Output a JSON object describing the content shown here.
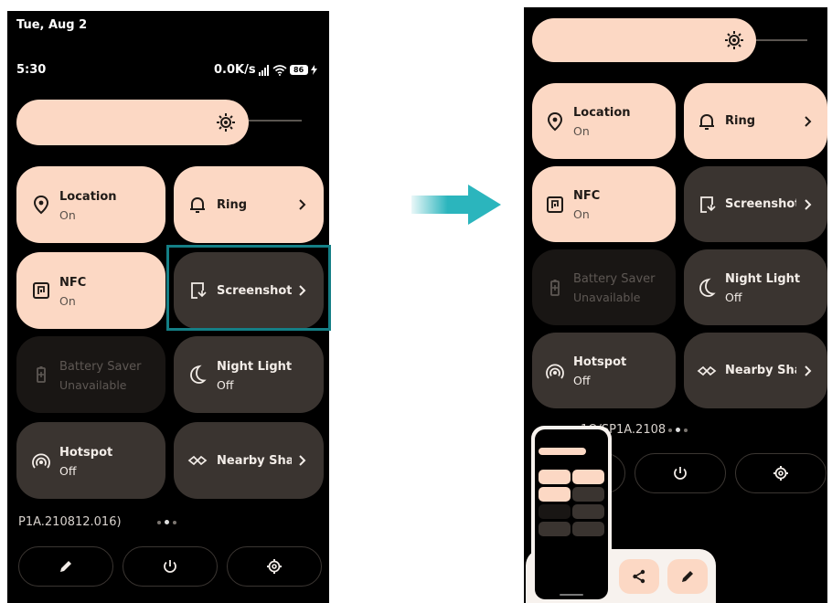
{
  "left_phone": {
    "status": {
      "date": "Tue, Aug 2",
      "time": "5:30",
      "net_speed": "0.0K/s",
      "battery": "86"
    },
    "tiles": {
      "location": {
        "label": "Location",
        "sub": "On"
      },
      "ring": {
        "label": "Ring"
      },
      "nfc": {
        "label": "NFC",
        "sub": "On"
      },
      "screenshot": {
        "label": "Screenshot"
      },
      "battery_saver": {
        "label": "Battery Saver",
        "sub": "Unavailable"
      },
      "night_light": {
        "label": "Night Light",
        "sub": "Off"
      },
      "hotspot": {
        "label": "Hotspot",
        "sub": "Off"
      },
      "nearby_share": {
        "label": "Nearby Share"
      }
    },
    "build_text": "P1A.210812.016)",
    "icons": {
      "edit": "pencil-icon",
      "power": "power-icon",
      "settings": "gear-icon"
    }
  },
  "right_phone": {
    "tiles": {
      "location": {
        "label": "Location",
        "sub": "On"
      },
      "ring": {
        "label": "Ring"
      },
      "nfc": {
        "label": "NFC",
        "sub": "On"
      },
      "screenshot": {
        "label": "Screenshot"
      },
      "battery_saver": {
        "label": "Battery Saver",
        "sub": "Unavailable"
      },
      "night_light": {
        "label": "Night Light",
        "sub": "Off"
      },
      "hotspot": {
        "label": "Hotspot",
        "sub": "Off"
      },
      "nearby_share": {
        "label": "Nearby Share"
      }
    },
    "build_text": "1Q/SP1A.2108",
    "preview_actions": {
      "share": "share-icon",
      "edit": "pencil-icon"
    }
  },
  "colors": {
    "tile_on": "#fcd8c4",
    "tile_off": "#3a3430",
    "tile_disabled": "#191614",
    "highlight": "#147f86",
    "arrow": "#2bb5bd"
  }
}
